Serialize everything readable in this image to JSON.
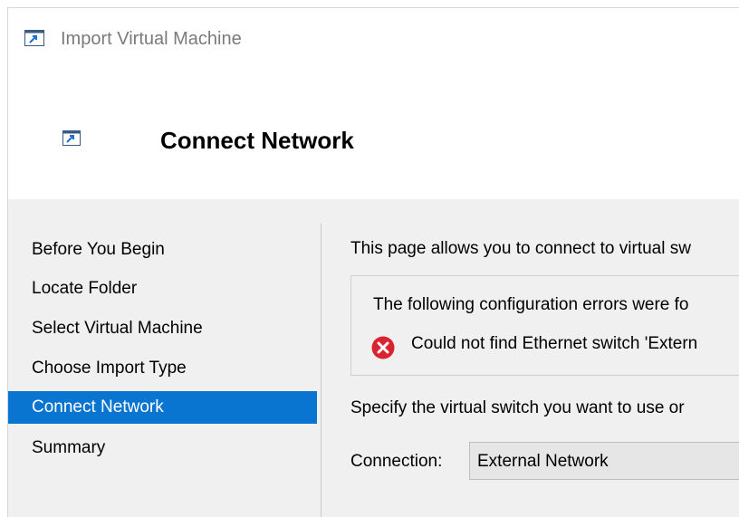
{
  "window": {
    "title": "Import Virtual Machine"
  },
  "header": {
    "title": "Connect Network"
  },
  "sidebar": {
    "items": [
      {
        "label": "Before You Begin"
      },
      {
        "label": "Locate Folder"
      },
      {
        "label": "Select Virtual Machine"
      },
      {
        "label": "Choose Import Type"
      },
      {
        "label": "Connect Network",
        "selected": true
      },
      {
        "label": "Summary"
      }
    ]
  },
  "main": {
    "intro": "This page allows you to connect to virtual sw",
    "errors": {
      "heading": "The following configuration errors were fo",
      "items": [
        {
          "icon": "error-icon",
          "text": "Could not find Ethernet switch 'Extern"
        }
      ]
    },
    "specify": "Specify the virtual switch you want to use or",
    "connection": {
      "label": "Connection:",
      "value": "External Network"
    }
  },
  "colors": {
    "selection": "#0a75d0",
    "error": "#d9232e",
    "panel": "#f0f0f0"
  }
}
